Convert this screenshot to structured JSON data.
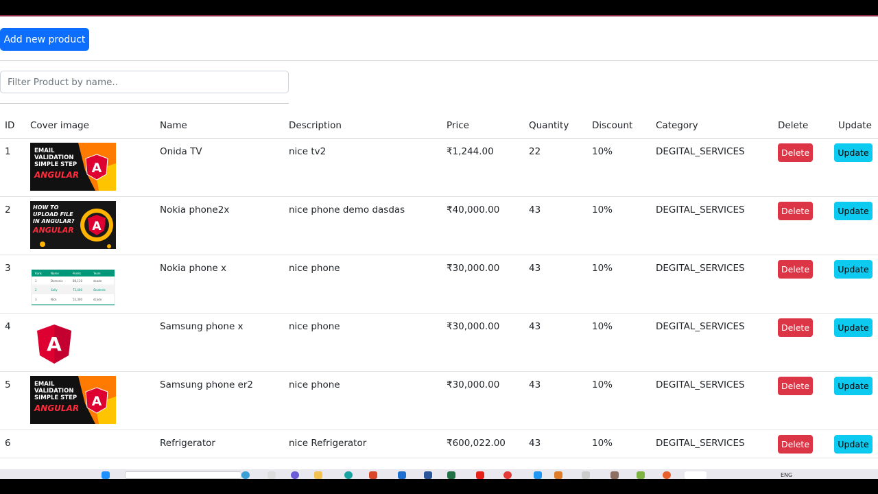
{
  "toolbar": {
    "add_label": "Add new product"
  },
  "filter": {
    "placeholder": "Filter Product by name.."
  },
  "table": {
    "headers": [
      "ID",
      "Cover image",
      "Name",
      "Description",
      "Price",
      "Quantity",
      "Discount",
      "Category",
      "Delete",
      "Update"
    ],
    "rows": [
      {
        "id": "1",
        "image": "email-validation",
        "name": "Onida TV",
        "description": "nice tv2",
        "price": "₹1,244.00",
        "quantity": "22",
        "discount": "10%",
        "category": "DEGITAL_SERVICES",
        "delete": "Delete",
        "update": "Update"
      },
      {
        "id": "2",
        "image": "upload-file",
        "name": "Nokia phone2x",
        "description": "nice phone demo dasdas",
        "price": "₹40,000.00",
        "quantity": "43",
        "discount": "10%",
        "category": "DEGITAL_SERVICES",
        "delete": "Delete",
        "update": "Update"
      },
      {
        "id": "3",
        "image": "table",
        "name": "Nokia phone x",
        "description": "nice phone",
        "price": "₹30,000.00",
        "quantity": "43",
        "discount": "10%",
        "category": "DEGITAL_SERVICES",
        "delete": "Delete",
        "update": "Update"
      },
      {
        "id": "4",
        "image": "angular-logo",
        "name": "Samsung phone x",
        "description": "nice phone",
        "price": "₹30,000.00",
        "quantity": "43",
        "discount": "10%",
        "category": "DEGITAL_SERVICES",
        "delete": "Delete",
        "update": "Update"
      },
      {
        "id": "5",
        "image": "email-validation",
        "name": "Samsung phone er2",
        "description": "nice phone",
        "price": "₹30,000.00",
        "quantity": "43",
        "discount": "10%",
        "category": "DEGITAL_SERVICES",
        "delete": "Delete",
        "update": "Update"
      },
      {
        "id": "6",
        "image": "",
        "name": "Refrigerator",
        "description": "nice Refrigerator",
        "price": "₹600,022.00",
        "quantity": "43",
        "discount": "10%",
        "category": "DEGITAL_SERVICES",
        "delete": "Delete",
        "update": "Update"
      }
    ]
  },
  "thumbnails": {
    "email": {
      "lines": [
        "EMAIL",
        "VALIDATION",
        "SIMPLE STEP"
      ],
      "brand": "ANGULAR",
      "letter": "A"
    },
    "upload": {
      "lines": [
        "HOW TO",
        "UPLOAD FILE",
        "IN ANGULAR?"
      ],
      "brand": "ANGULAR",
      "letter": "A"
    },
    "table": {
      "headers": [
        "Rank",
        "Name",
        "Points",
        "Team"
      ],
      "rows": [
        [
          "1",
          "Domenic",
          "88,110",
          "dcode"
        ],
        [
          "2",
          "Sally",
          "72,400",
          "Students"
        ],
        [
          "3",
          "Nick",
          "52,300",
          "dcode"
        ]
      ]
    },
    "logo": {
      "letter": "A"
    }
  },
  "taskbar": {
    "lang": "ENG"
  },
  "colors": {
    "primary": "#0d6efd",
    "danger": "#dc3545",
    "info": "#0dcaf0",
    "angular_red": "#dd0031"
  }
}
